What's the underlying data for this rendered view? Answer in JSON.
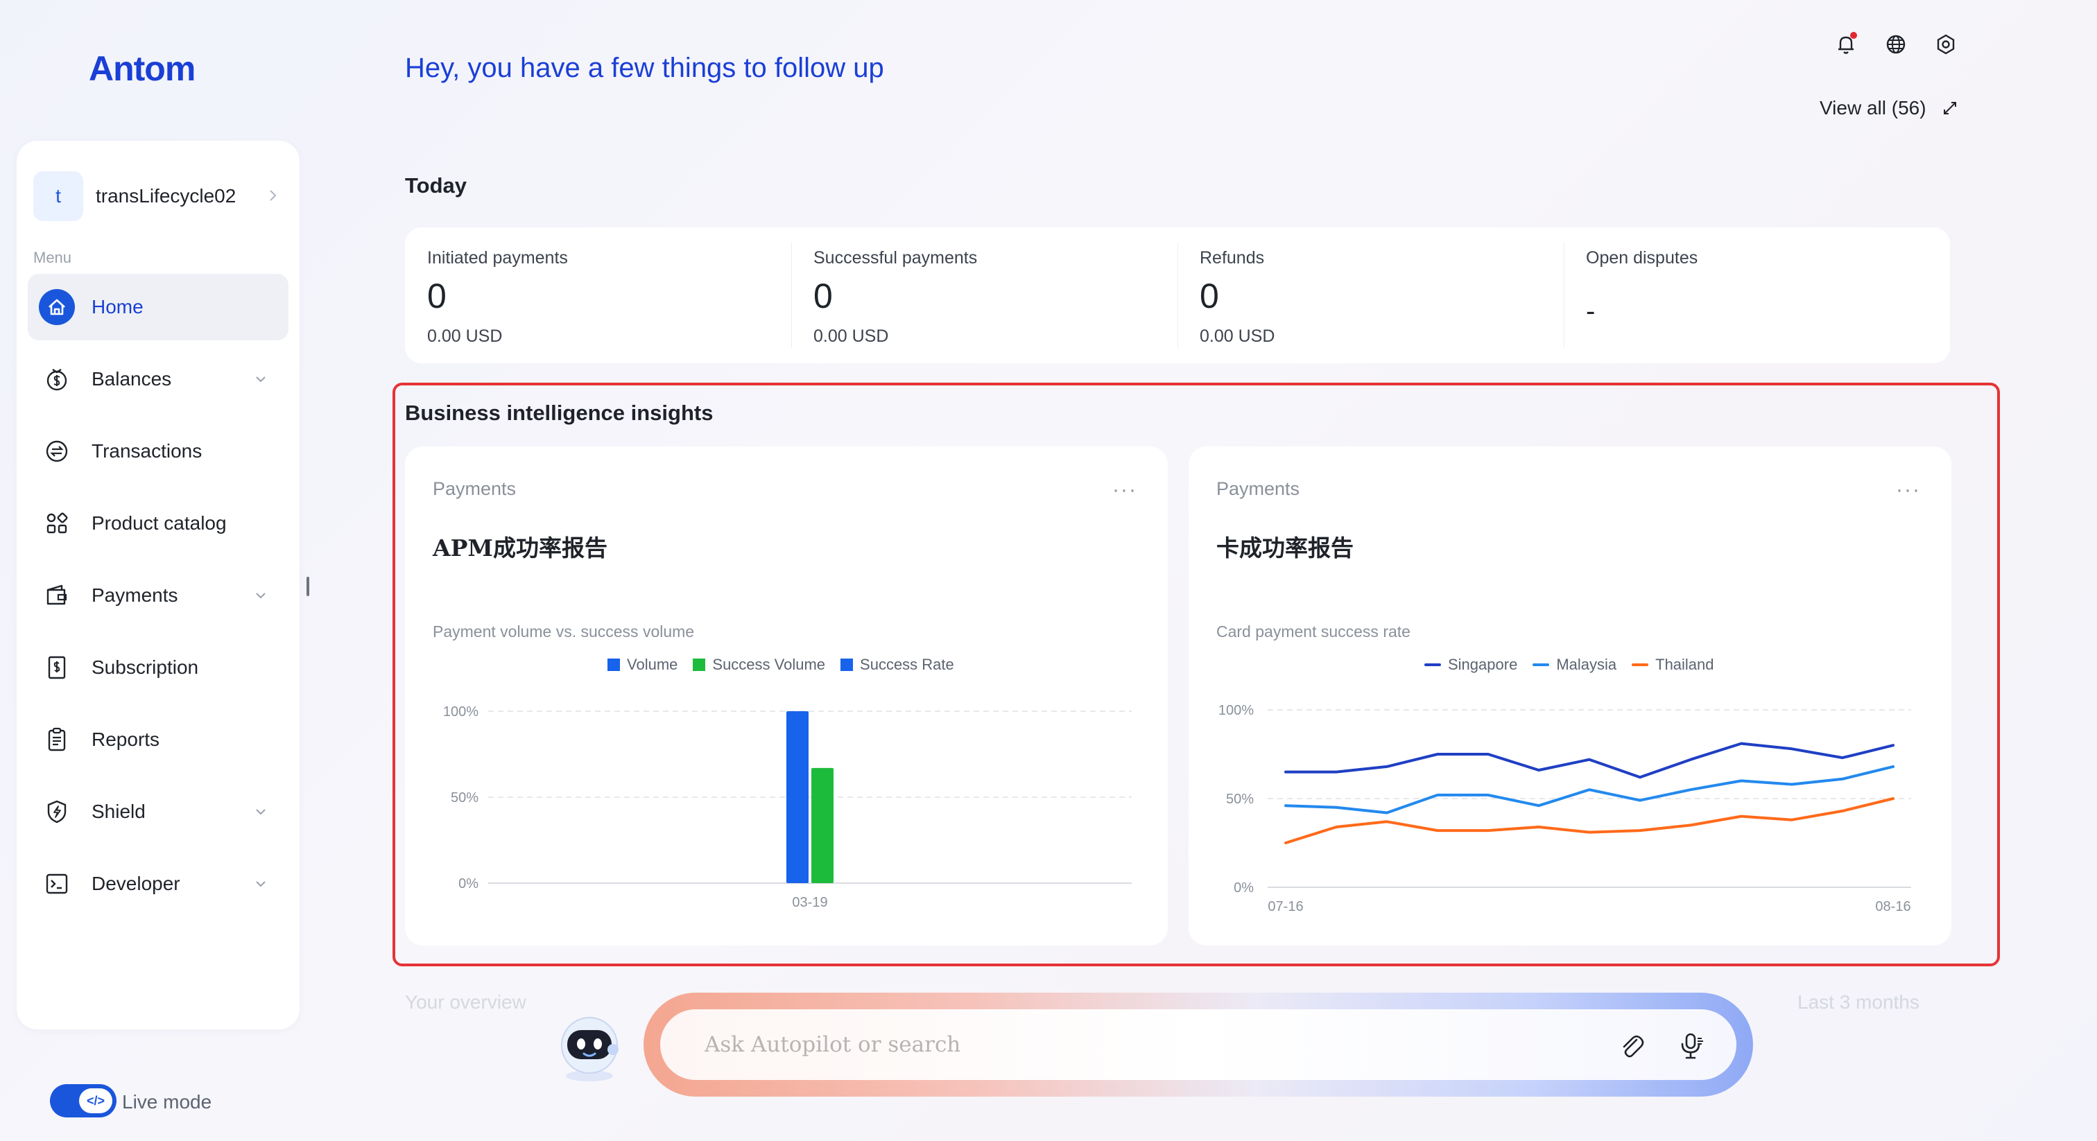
{
  "brand": {
    "logo_text": "Antom"
  },
  "sidebar": {
    "account_initial": "t",
    "account_name": "transLifecycle02",
    "menu_label": "Menu",
    "items": [
      {
        "label": "Home",
        "icon": "home-icon",
        "active": true,
        "has_chevron": false
      },
      {
        "label": "Balances",
        "icon": "balance-icon",
        "has_chevron": true
      },
      {
        "label": "Transactions",
        "icon": "transactions-icon",
        "has_chevron": false
      },
      {
        "label": "Product catalog",
        "icon": "catalog-icon",
        "has_chevron": false
      },
      {
        "label": "Payments",
        "icon": "wallet-icon",
        "has_chevron": true
      },
      {
        "label": "Subscription",
        "icon": "subscription-icon",
        "has_chevron": false
      },
      {
        "label": "Reports",
        "icon": "reports-icon",
        "has_chevron": false
      },
      {
        "label": "Shield",
        "icon": "shield-icon",
        "has_chevron": true
      },
      {
        "label": "Developer",
        "icon": "terminal-icon",
        "has_chevron": true
      }
    ],
    "live_mode_label": "Live mode",
    "live_mode_on": true,
    "live_knob_glyph": "</>"
  },
  "header": {
    "greeting": "Hey, you have a few things to follow up",
    "view_all": "View all (56)"
  },
  "today": {
    "title": "Today",
    "stats": [
      {
        "label": "Initiated payments",
        "value": "0",
        "sub": "0.00 USD"
      },
      {
        "label": "Successful payments",
        "value": "0",
        "sub": "0.00 USD"
      },
      {
        "label": "Refunds",
        "value": "0",
        "sub": "0.00 USD"
      },
      {
        "label": "Open disputes",
        "value": "-",
        "sub": ""
      }
    ]
  },
  "bi": {
    "title": "Business intelligence insights",
    "cards": [
      {
        "category": "Payments",
        "more": "···",
        "title": "APM成功率报告",
        "subtitle": "Payment volume vs. success volume"
      },
      {
        "category": "Payments",
        "more": "···",
        "title": "卡成功率报告",
        "subtitle": "Card payment success rate"
      }
    ]
  },
  "chart_data": [
    {
      "type": "bar",
      "title": "Payment volume vs. success volume",
      "categories": [
        "03-19"
      ],
      "series": [
        {
          "name": "Volume",
          "color": "#1763ec",
          "values": [
            100
          ]
        },
        {
          "name": "Success Volume",
          "color": "#1dbb3c",
          "values": [
            67
          ]
        },
        {
          "name": "Success Rate",
          "color": "#1763ec",
          "values": [
            null
          ]
        }
      ],
      "y_ticks": [
        "0%",
        "50%",
        "100%"
      ],
      "ylim": [
        0,
        100
      ],
      "grid": true,
      "legend": "top"
    },
    {
      "type": "line",
      "title": "Card payment success rate",
      "x_labels": [
        "07-16",
        "08-16"
      ],
      "series": [
        {
          "name": "Singapore",
          "color": "#1f3fc4",
          "values": [
            65,
            65,
            68,
            75,
            75,
            66,
            72,
            62,
            72,
            81,
            78,
            73,
            80
          ]
        },
        {
          "name": "Malaysia",
          "color": "#2389ee",
          "values": [
            46,
            45,
            42,
            52,
            52,
            46,
            55,
            49,
            55,
            60,
            58,
            61,
            68
          ]
        },
        {
          "name": "Thailand",
          "color": "#ff6a1a",
          "values": [
            25,
            34,
            37,
            32,
            32,
            34,
            31,
            32,
            35,
            40,
            38,
            43,
            50
          ]
        }
      ],
      "y_ticks": [
        "0%",
        "50%",
        "100%"
      ],
      "ylim": [
        0,
        100
      ],
      "grid": true,
      "legend": "top"
    }
  ],
  "overview": {
    "title": "Your overview",
    "range": "Last 3 months"
  },
  "autopilot": {
    "placeholder": "Ask Autopilot or search"
  }
}
